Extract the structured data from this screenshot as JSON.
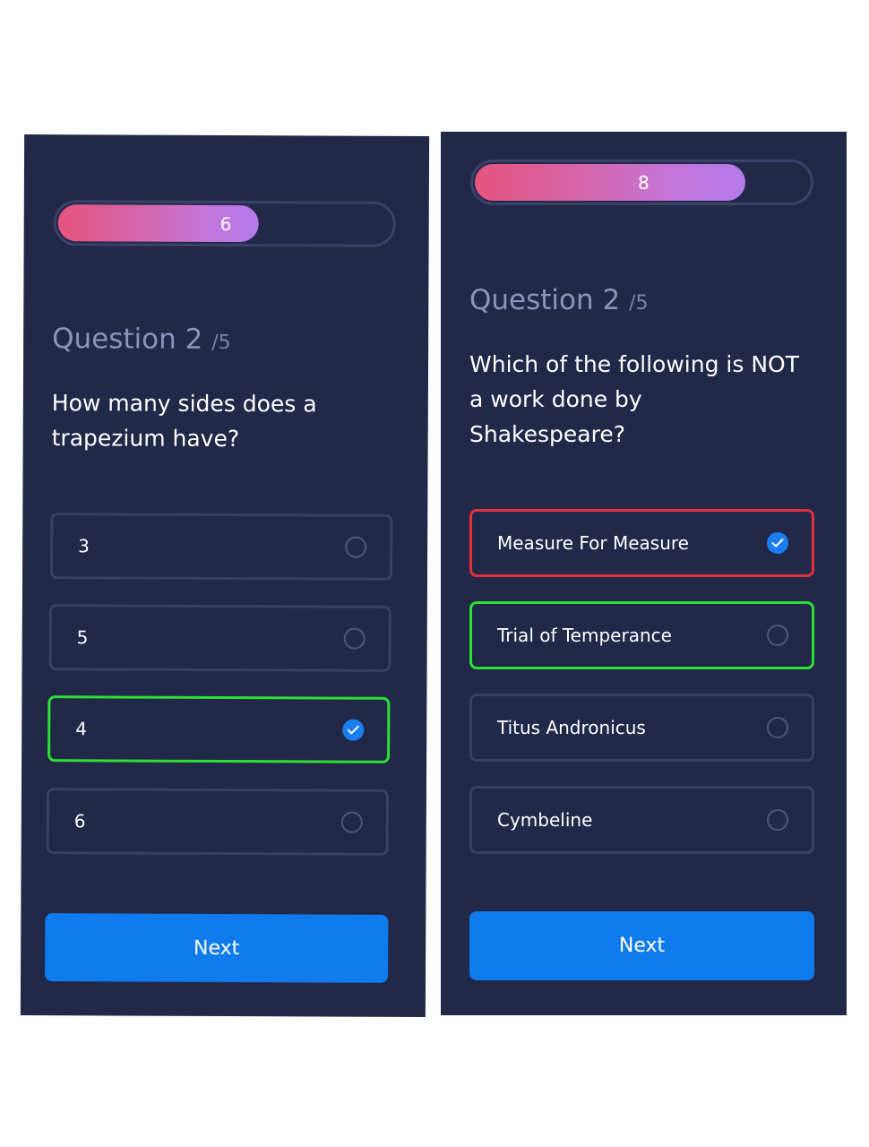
{
  "screens": [
    {
      "progress": {
        "value_label": "6",
        "fill_fraction": 0.61
      },
      "question": {
        "heading": "Question 2",
        "total": "/5",
        "text_line1": "How many sides does a",
        "text_line2": "trapezium have?"
      },
      "options": [
        {
          "label": "3",
          "state": "unselected"
        },
        {
          "label": "5",
          "state": "unselected"
        },
        {
          "label": "4",
          "state": "selected-correct"
        },
        {
          "label": "6",
          "state": "unselected"
        }
      ],
      "next_label": "Next"
    },
    {
      "progress": {
        "value_label": "8",
        "fill_fraction": 0.8
      },
      "question": {
        "heading": "Question 2",
        "total": "/5",
        "text_line1": "Which of the following is NOT",
        "text_line2": "a work done by",
        "text_line3": "Shakespeare?"
      },
      "options": [
        {
          "label": "Measure For Measure",
          "state": "selected-wrong"
        },
        {
          "label": "Trial of Temperance",
          "state": "correct"
        },
        {
          "label": "Titus Andronicus",
          "state": "unselected"
        },
        {
          "label": "Cymbeline",
          "state": "unselected"
        }
      ],
      "next_label": "Next"
    }
  ],
  "icons": {
    "checked": "checkmark-icon",
    "unchecked": "radio-empty-icon"
  },
  "colors": {
    "background": "#212848",
    "correct_border": "#2ce034",
    "wrong_border": "#e2303c",
    "button": "#0f7bec",
    "check": "#1a7df0",
    "progress_start": "#e6547e",
    "progress_end": "#b57aec"
  }
}
